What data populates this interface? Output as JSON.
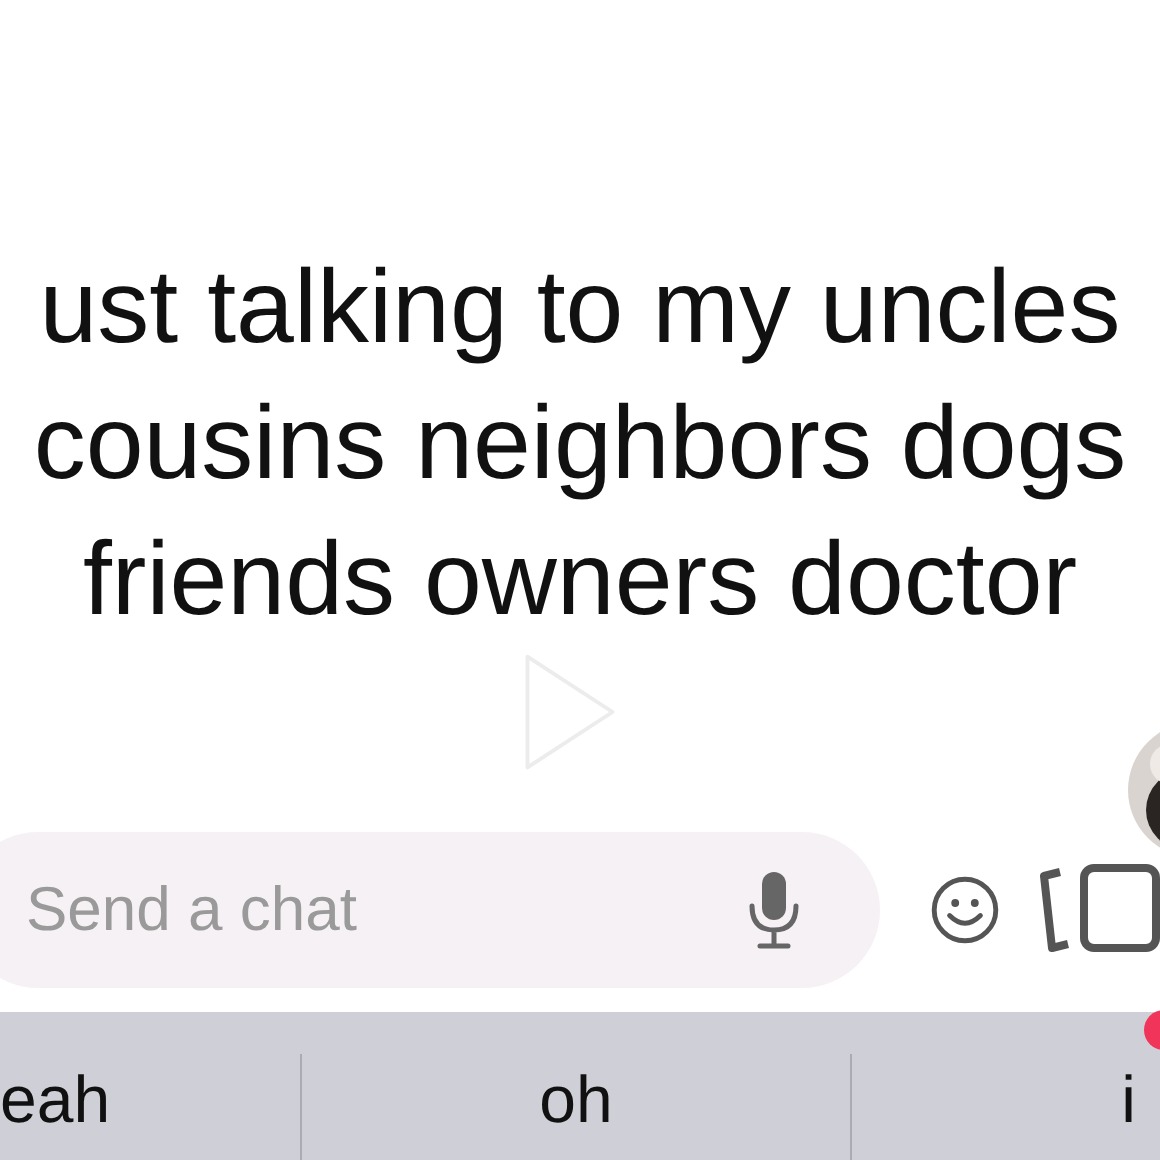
{
  "caption": {
    "lines": [
      "ust talking to my uncles",
      "cousins neighbors dogs",
      "friends owners doctor"
    ]
  },
  "chat_input": {
    "placeholder": "Send a chat"
  },
  "suggestions": [
    "eah",
    "oh",
    "i"
  ]
}
